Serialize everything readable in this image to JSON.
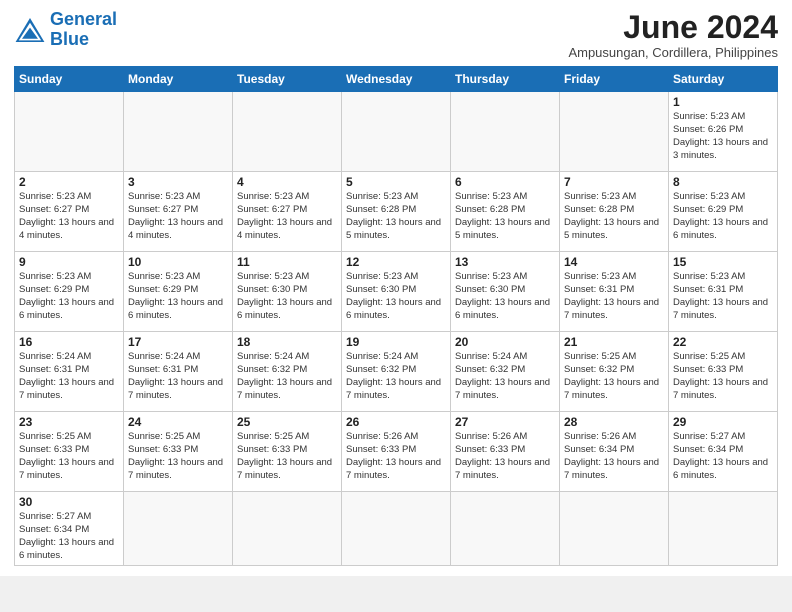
{
  "header": {
    "logo_general": "General",
    "logo_blue": "Blue",
    "month_title": "June 2024",
    "subtitle": "Ampusungan, Cordillera, Philippines"
  },
  "weekdays": [
    "Sunday",
    "Monday",
    "Tuesday",
    "Wednesday",
    "Thursday",
    "Friday",
    "Saturday"
  ],
  "weeks": [
    [
      {
        "day": "",
        "info": ""
      },
      {
        "day": "",
        "info": ""
      },
      {
        "day": "",
        "info": ""
      },
      {
        "day": "",
        "info": ""
      },
      {
        "day": "",
        "info": ""
      },
      {
        "day": "",
        "info": ""
      },
      {
        "day": "1",
        "info": "Sunrise: 5:23 AM\nSunset: 6:26 PM\nDaylight: 13 hours and 3 minutes."
      }
    ],
    [
      {
        "day": "2",
        "info": "Sunrise: 5:23 AM\nSunset: 6:27 PM\nDaylight: 13 hours and 4 minutes."
      },
      {
        "day": "3",
        "info": "Sunrise: 5:23 AM\nSunset: 6:27 PM\nDaylight: 13 hours and 4 minutes."
      },
      {
        "day": "4",
        "info": "Sunrise: 5:23 AM\nSunset: 6:27 PM\nDaylight: 13 hours and 4 minutes."
      },
      {
        "day": "5",
        "info": "Sunrise: 5:23 AM\nSunset: 6:28 PM\nDaylight: 13 hours and 5 minutes."
      },
      {
        "day": "6",
        "info": "Sunrise: 5:23 AM\nSunset: 6:28 PM\nDaylight: 13 hours and 5 minutes."
      },
      {
        "day": "7",
        "info": "Sunrise: 5:23 AM\nSunset: 6:28 PM\nDaylight: 13 hours and 5 minutes."
      },
      {
        "day": "8",
        "info": "Sunrise: 5:23 AM\nSunset: 6:29 PM\nDaylight: 13 hours and 6 minutes."
      }
    ],
    [
      {
        "day": "9",
        "info": "Sunrise: 5:23 AM\nSunset: 6:29 PM\nDaylight: 13 hours and 6 minutes."
      },
      {
        "day": "10",
        "info": "Sunrise: 5:23 AM\nSunset: 6:29 PM\nDaylight: 13 hours and 6 minutes."
      },
      {
        "day": "11",
        "info": "Sunrise: 5:23 AM\nSunset: 6:30 PM\nDaylight: 13 hours and 6 minutes."
      },
      {
        "day": "12",
        "info": "Sunrise: 5:23 AM\nSunset: 6:30 PM\nDaylight: 13 hours and 6 minutes."
      },
      {
        "day": "13",
        "info": "Sunrise: 5:23 AM\nSunset: 6:30 PM\nDaylight: 13 hours and 6 minutes."
      },
      {
        "day": "14",
        "info": "Sunrise: 5:23 AM\nSunset: 6:31 PM\nDaylight: 13 hours and 7 minutes."
      },
      {
        "day": "15",
        "info": "Sunrise: 5:23 AM\nSunset: 6:31 PM\nDaylight: 13 hours and 7 minutes."
      }
    ],
    [
      {
        "day": "16",
        "info": "Sunrise: 5:24 AM\nSunset: 6:31 PM\nDaylight: 13 hours and 7 minutes."
      },
      {
        "day": "17",
        "info": "Sunrise: 5:24 AM\nSunset: 6:31 PM\nDaylight: 13 hours and 7 minutes."
      },
      {
        "day": "18",
        "info": "Sunrise: 5:24 AM\nSunset: 6:32 PM\nDaylight: 13 hours and 7 minutes."
      },
      {
        "day": "19",
        "info": "Sunrise: 5:24 AM\nSunset: 6:32 PM\nDaylight: 13 hours and 7 minutes."
      },
      {
        "day": "20",
        "info": "Sunrise: 5:24 AM\nSunset: 6:32 PM\nDaylight: 13 hours and 7 minutes."
      },
      {
        "day": "21",
        "info": "Sunrise: 5:25 AM\nSunset: 6:32 PM\nDaylight: 13 hours and 7 minutes."
      },
      {
        "day": "22",
        "info": "Sunrise: 5:25 AM\nSunset: 6:33 PM\nDaylight: 13 hours and 7 minutes."
      }
    ],
    [
      {
        "day": "23",
        "info": "Sunrise: 5:25 AM\nSunset: 6:33 PM\nDaylight: 13 hours and 7 minutes."
      },
      {
        "day": "24",
        "info": "Sunrise: 5:25 AM\nSunset: 6:33 PM\nDaylight: 13 hours and 7 minutes."
      },
      {
        "day": "25",
        "info": "Sunrise: 5:25 AM\nSunset: 6:33 PM\nDaylight: 13 hours and 7 minutes."
      },
      {
        "day": "26",
        "info": "Sunrise: 5:26 AM\nSunset: 6:33 PM\nDaylight: 13 hours and 7 minutes."
      },
      {
        "day": "27",
        "info": "Sunrise: 5:26 AM\nSunset: 6:33 PM\nDaylight: 13 hours and 7 minutes."
      },
      {
        "day": "28",
        "info": "Sunrise: 5:26 AM\nSunset: 6:34 PM\nDaylight: 13 hours and 7 minutes."
      },
      {
        "day": "29",
        "info": "Sunrise: 5:27 AM\nSunset: 6:34 PM\nDaylight: 13 hours and 6 minutes."
      }
    ],
    [
      {
        "day": "30",
        "info": "Sunrise: 5:27 AM\nSunset: 6:34 PM\nDaylight: 13 hours and 6 minutes."
      },
      {
        "day": "",
        "info": ""
      },
      {
        "day": "",
        "info": ""
      },
      {
        "day": "",
        "info": ""
      },
      {
        "day": "",
        "info": ""
      },
      {
        "day": "",
        "info": ""
      },
      {
        "day": "",
        "info": ""
      }
    ]
  ]
}
